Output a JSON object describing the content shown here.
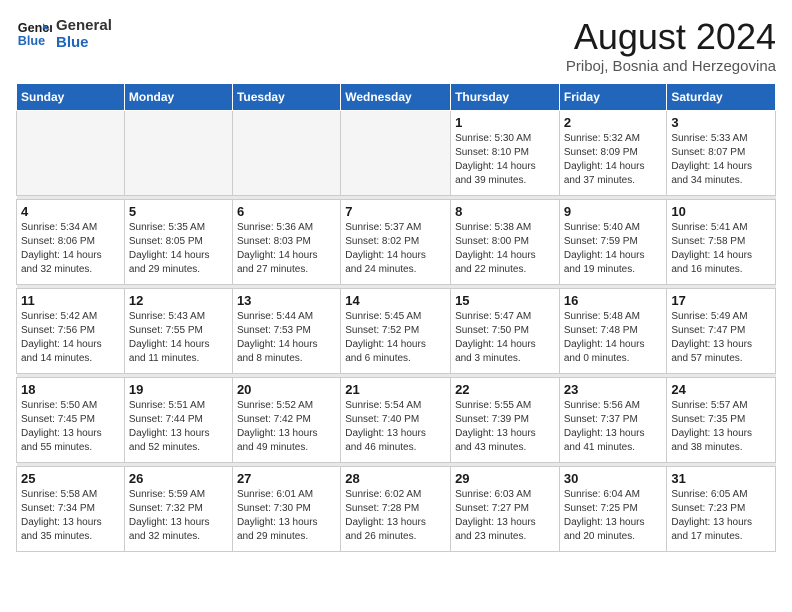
{
  "logo": {
    "line1": "General",
    "line2": "Blue"
  },
  "title": "August 2024",
  "subtitle": "Priboj, Bosnia and Herzegovina",
  "days_of_week": [
    "Sunday",
    "Monday",
    "Tuesday",
    "Wednesday",
    "Thursday",
    "Friday",
    "Saturday"
  ],
  "weeks": [
    [
      {
        "day": "",
        "info": ""
      },
      {
        "day": "",
        "info": ""
      },
      {
        "day": "",
        "info": ""
      },
      {
        "day": "",
        "info": ""
      },
      {
        "day": "1",
        "info": "Sunrise: 5:30 AM\nSunset: 8:10 PM\nDaylight: 14 hours\nand 39 minutes."
      },
      {
        "day": "2",
        "info": "Sunrise: 5:32 AM\nSunset: 8:09 PM\nDaylight: 14 hours\nand 37 minutes."
      },
      {
        "day": "3",
        "info": "Sunrise: 5:33 AM\nSunset: 8:07 PM\nDaylight: 14 hours\nand 34 minutes."
      }
    ],
    [
      {
        "day": "4",
        "info": "Sunrise: 5:34 AM\nSunset: 8:06 PM\nDaylight: 14 hours\nand 32 minutes."
      },
      {
        "day": "5",
        "info": "Sunrise: 5:35 AM\nSunset: 8:05 PM\nDaylight: 14 hours\nand 29 minutes."
      },
      {
        "day": "6",
        "info": "Sunrise: 5:36 AM\nSunset: 8:03 PM\nDaylight: 14 hours\nand 27 minutes."
      },
      {
        "day": "7",
        "info": "Sunrise: 5:37 AM\nSunset: 8:02 PM\nDaylight: 14 hours\nand 24 minutes."
      },
      {
        "day": "8",
        "info": "Sunrise: 5:38 AM\nSunset: 8:00 PM\nDaylight: 14 hours\nand 22 minutes."
      },
      {
        "day": "9",
        "info": "Sunrise: 5:40 AM\nSunset: 7:59 PM\nDaylight: 14 hours\nand 19 minutes."
      },
      {
        "day": "10",
        "info": "Sunrise: 5:41 AM\nSunset: 7:58 PM\nDaylight: 14 hours\nand 16 minutes."
      }
    ],
    [
      {
        "day": "11",
        "info": "Sunrise: 5:42 AM\nSunset: 7:56 PM\nDaylight: 14 hours\nand 14 minutes."
      },
      {
        "day": "12",
        "info": "Sunrise: 5:43 AM\nSunset: 7:55 PM\nDaylight: 14 hours\nand 11 minutes."
      },
      {
        "day": "13",
        "info": "Sunrise: 5:44 AM\nSunset: 7:53 PM\nDaylight: 14 hours\nand 8 minutes."
      },
      {
        "day": "14",
        "info": "Sunrise: 5:45 AM\nSunset: 7:52 PM\nDaylight: 14 hours\nand 6 minutes."
      },
      {
        "day": "15",
        "info": "Sunrise: 5:47 AM\nSunset: 7:50 PM\nDaylight: 14 hours\nand 3 minutes."
      },
      {
        "day": "16",
        "info": "Sunrise: 5:48 AM\nSunset: 7:48 PM\nDaylight: 14 hours\nand 0 minutes."
      },
      {
        "day": "17",
        "info": "Sunrise: 5:49 AM\nSunset: 7:47 PM\nDaylight: 13 hours\nand 57 minutes."
      }
    ],
    [
      {
        "day": "18",
        "info": "Sunrise: 5:50 AM\nSunset: 7:45 PM\nDaylight: 13 hours\nand 55 minutes."
      },
      {
        "day": "19",
        "info": "Sunrise: 5:51 AM\nSunset: 7:44 PM\nDaylight: 13 hours\nand 52 minutes."
      },
      {
        "day": "20",
        "info": "Sunrise: 5:52 AM\nSunset: 7:42 PM\nDaylight: 13 hours\nand 49 minutes."
      },
      {
        "day": "21",
        "info": "Sunrise: 5:54 AM\nSunset: 7:40 PM\nDaylight: 13 hours\nand 46 minutes."
      },
      {
        "day": "22",
        "info": "Sunrise: 5:55 AM\nSunset: 7:39 PM\nDaylight: 13 hours\nand 43 minutes."
      },
      {
        "day": "23",
        "info": "Sunrise: 5:56 AM\nSunset: 7:37 PM\nDaylight: 13 hours\nand 41 minutes."
      },
      {
        "day": "24",
        "info": "Sunrise: 5:57 AM\nSunset: 7:35 PM\nDaylight: 13 hours\nand 38 minutes."
      }
    ],
    [
      {
        "day": "25",
        "info": "Sunrise: 5:58 AM\nSunset: 7:34 PM\nDaylight: 13 hours\nand 35 minutes."
      },
      {
        "day": "26",
        "info": "Sunrise: 5:59 AM\nSunset: 7:32 PM\nDaylight: 13 hours\nand 32 minutes."
      },
      {
        "day": "27",
        "info": "Sunrise: 6:01 AM\nSunset: 7:30 PM\nDaylight: 13 hours\nand 29 minutes."
      },
      {
        "day": "28",
        "info": "Sunrise: 6:02 AM\nSunset: 7:28 PM\nDaylight: 13 hours\nand 26 minutes."
      },
      {
        "day": "29",
        "info": "Sunrise: 6:03 AM\nSunset: 7:27 PM\nDaylight: 13 hours\nand 23 minutes."
      },
      {
        "day": "30",
        "info": "Sunrise: 6:04 AM\nSunset: 7:25 PM\nDaylight: 13 hours\nand 20 minutes."
      },
      {
        "day": "31",
        "info": "Sunrise: 6:05 AM\nSunset: 7:23 PM\nDaylight: 13 hours\nand 17 minutes."
      }
    ]
  ]
}
